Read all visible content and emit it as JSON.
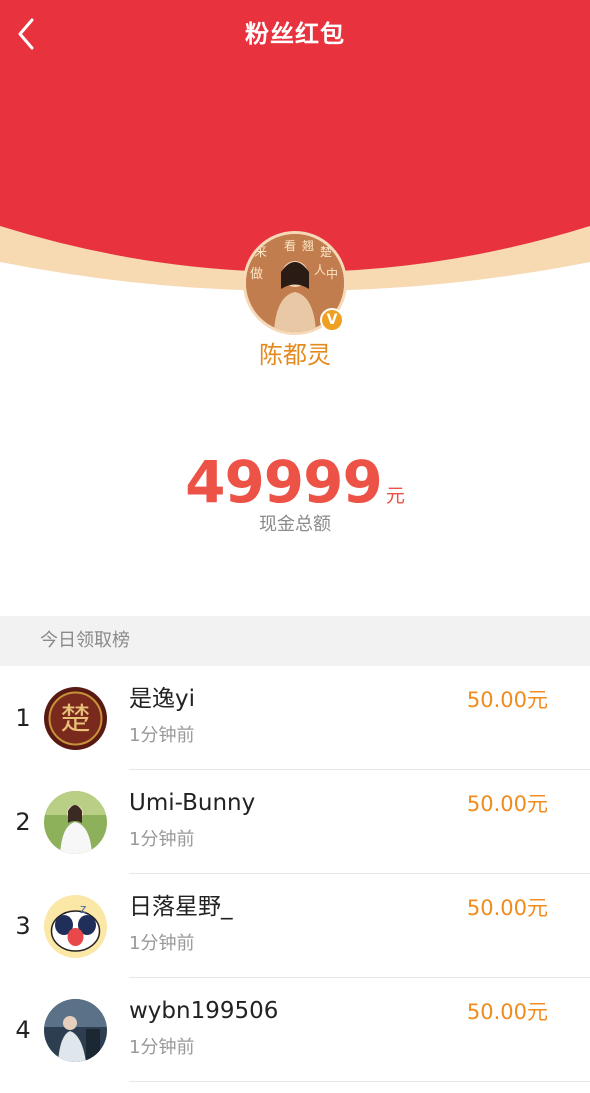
{
  "header": {
    "title": "粉丝红包",
    "back_icon": "chevron-left-icon",
    "colors": {
      "red": "#e8333e",
      "cream": "#f7d9b2"
    }
  },
  "host": {
    "name": "陈都灵",
    "verified_badge": "V",
    "avatar_text": [
      "来",
      "看",
      "翘",
      "楚",
      "做",
      "人",
      "中"
    ]
  },
  "summary": {
    "amount": "49999",
    "unit": "元",
    "label": "现金总额"
  },
  "leaderboard": {
    "title": "今日领取榜",
    "rows": [
      {
        "rank": "1",
        "name": "是逸yi",
        "time": "1分钟前",
        "amount": "50.00元",
        "avatar_text": "楚"
      },
      {
        "rank": "2",
        "name": "Umi-Bunny",
        "time": "1分钟前",
        "amount": "50.00元"
      },
      {
        "rank": "3",
        "name": "日落星野_",
        "time": "1分钟前",
        "amount": "50.00元",
        "avatar_text": "z"
      },
      {
        "rank": "4",
        "name": "wybn199506",
        "time": "1分钟前",
        "amount": "50.00元"
      }
    ]
  },
  "colors": {
    "amount": "#ec5246",
    "reward": "#ef8c1d",
    "host_name": "#e58a1f"
  }
}
